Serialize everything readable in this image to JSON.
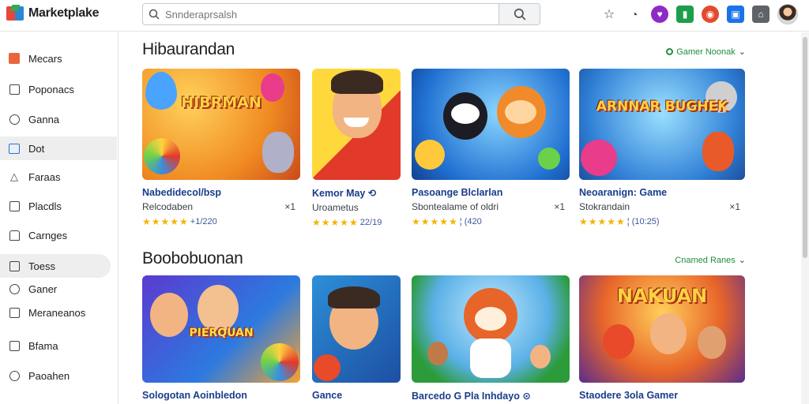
{
  "app": {
    "name": "Marketplake"
  },
  "search": {
    "placeholder": "Snnderaprsalsh"
  },
  "sidebar": {
    "items": [
      {
        "label": "Mecars",
        "icon": "store-icon"
      },
      {
        "label": "Poponacs",
        "icon": "document-icon"
      },
      {
        "label": "Ganna",
        "icon": "chat-icon"
      },
      {
        "label": "Dot",
        "icon": "folder-icon"
      },
      {
        "label": "Faraas",
        "icon": "tag-icon"
      },
      {
        "label": "Placdls",
        "icon": "image-icon"
      },
      {
        "label": "Carnges",
        "icon": "package-icon"
      },
      {
        "label": "Toess",
        "icon": "window-icon"
      },
      {
        "label": "Ganer",
        "icon": "circle-icon"
      },
      {
        "label": "Meraneanos",
        "icon": "list-icon"
      },
      {
        "label": "Bfama",
        "icon": "share-icon"
      },
      {
        "label": "Paoahen",
        "icon": "person-icon"
      }
    ]
  },
  "sections": [
    {
      "title": "Hibaurandan",
      "link": "Gamer Noonak",
      "cards": [
        {
          "title": "Nabedidecol/bsp",
          "sub": "Relcodaben",
          "count": "×1",
          "rating": "+1/220",
          "art": "HIBRMAN"
        },
        {
          "title": "Kemor May ⟲",
          "sub": "Uroametus",
          "count": "",
          "rating": "22/19",
          "art": ""
        },
        {
          "title": "Pasoange Blclarlan",
          "sub": "Sbontealame of oldri",
          "count": "×1",
          "rating": "¦ (420",
          "art": ""
        },
        {
          "title": "Neoaranign: Game",
          "sub": "Stokrandain",
          "count": "×1",
          "rating": "¦ (10:25)",
          "art": "ARNNAR BUGHEK"
        }
      ]
    },
    {
      "title": "Boobobuonan",
      "link": "Cnamed Ranes",
      "cards": [
        {
          "title": "Sologotan Aoinbledon",
          "art": "PIERQUAN"
        },
        {
          "title": "Gance",
          "art": ""
        },
        {
          "title": "Barcedo G Pla Inhdayo ⊙",
          "art": ""
        },
        {
          "title": "Staodere 3ola Gamer",
          "art": "NAKUAN"
        }
      ]
    }
  ],
  "colors": {
    "accent": "#1a73e8",
    "link_green": "#1e8e3e",
    "star": "#f4b400",
    "card_title": "#1a3c8a"
  }
}
